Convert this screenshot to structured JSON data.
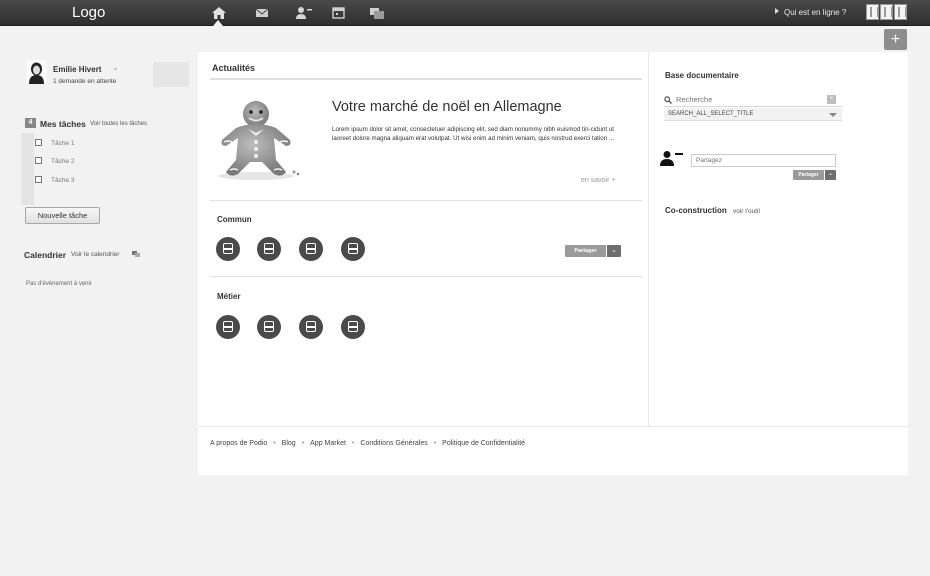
{
  "topbar": {
    "logo": "Logo",
    "nav": [
      {
        "icon": "home-icon"
      },
      {
        "icon": "mail-icon"
      },
      {
        "icon": "user-remove-icon"
      },
      {
        "icon": "calendar-icon"
      },
      {
        "icon": "chat-icon"
      }
    ],
    "online_label": "Qui est en ligne ?"
  },
  "actions": {
    "plus_label": "+"
  },
  "profile": {
    "name": "Emilie Hivert",
    "pending": "1 demande en attente",
    "caret": "⌄"
  },
  "tasks": {
    "count": "4",
    "title": "Mes tâches",
    "see_all": "Voir toutes les tâches",
    "items": [
      "Tâche 1",
      "Tâche 2",
      "Tâche 3"
    ],
    "new_button": "Nouvelle tâche"
  },
  "calendar": {
    "title": "Calendrier",
    "link": "Voir le calendrier",
    "empty": "Pas d'évènement à venir"
  },
  "news": {
    "section_title": "Actualités",
    "heading": "Votre marché de noël en Allemagne",
    "body": "Lorem ipsum dolor sit amet, consectetuer adipiscing elit, sed diam nonummy nibh euismod tin-cidunt ut laoreet dolore magna aliquam erat volutpat. Ut wisi enim ad minim veniam, quis nostrud exerci tation ...",
    "more": "en savoir +"
  },
  "commun": {
    "title": "Commun",
    "share_label": "Partager",
    "share_caret": "⌄",
    "app_count": 4
  },
  "metier": {
    "title": "Métier",
    "app_count": 4
  },
  "documents": {
    "title": "Base documentaire",
    "search_placeholder": "Recherche",
    "clear_label": "×",
    "select_value": "SEARCH_ALL_SELECT_TITLE",
    "share_placeholder": "Partagez",
    "share_label": "Partager",
    "share_caret": "⌄"
  },
  "coconstruction": {
    "title": "Co-construction",
    "link": "voir l'outil"
  },
  "footer": {
    "links": [
      "A propos de Podio",
      "Blog",
      "App Market",
      "Conditions Générales",
      "Politique de Confidentialité"
    ],
    "separator": "•"
  },
  "colors": {
    "topbar": "#3a3a3a",
    "app_icon": "#4a4a4a",
    "button_grey": "#9a9a9a"
  }
}
